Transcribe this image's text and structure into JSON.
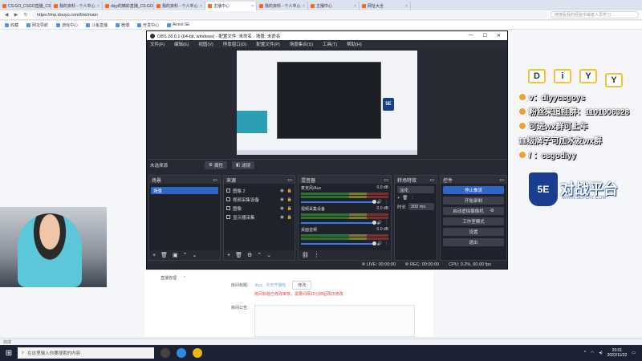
{
  "browser": {
    "tabs": [
      {
        "label": "CS:GO_CSGO直播_CS..",
        "active": false
      },
      {
        "label": "我的资料 - 个人中心",
        "active": false
      },
      {
        "label": "diyy的精彩直播_CS:GO直播",
        "active": false
      },
      {
        "label": "我的资料 - 个人中心",
        "active": false
      },
      {
        "label": "主播中心",
        "active": true
      },
      {
        "label": "我的资料 - 个人中心",
        "active": false
      },
      {
        "label": "主播中心",
        "active": false
      },
      {
        "label": "网址大全",
        "active": false
      }
    ],
    "url": "https://mp.douyu.com/live/main",
    "search_placeholder": "搜搜看我的经验中或者人员学习",
    "bookmarks": [
      "收藏",
      "网址导航",
      "游戏中心",
      "斗鱼直播",
      "微博",
      "开发中心",
      "Arrest SE"
    ]
  },
  "page": {
    "form": {
      "title_label": "房间标题:",
      "title_value": "diyy，今天开播啦",
      "edit_button": "修改",
      "warning": "房间标题已修改审核，需要间隔10分钟后再次修改",
      "notice_label": "房间公告:",
      "live_manage": "直播管理"
    },
    "statusbar": "完成"
  },
  "overlay": {
    "letters": [
      "D",
      "i",
      "Y",
      "Y"
    ],
    "lines": [
      "v：diyycsgoys",
      "粉丝来追挂群：1101906328",
      "可进wx群可上车",
      "11级牌子可加水友wx群",
      "/ ：csgodiyy"
    ],
    "se_logo": "5E",
    "se_text": "对战平台",
    "se_url": "WWW.5EPLAY.COM"
  },
  "obs": {
    "title": "OBS 28.0.1 (64-bit, windows) - 配置文件: 未命名 - 场景: 未命名",
    "window_controls": [
      "—",
      "☐",
      "✕"
    ],
    "menu": [
      "文件(F)",
      "编辑(E)",
      "视图(V)",
      "停靠窗口(D)",
      "配置文件(P)",
      "场景集合(S)",
      "工具(T)",
      "帮助(H)"
    ],
    "source_bar": {
      "label": "未选择源",
      "props": "属性",
      "filters": "滤镜"
    },
    "scenes": {
      "title": "场景",
      "items": [
        "场景"
      ]
    },
    "sources": {
      "title": "来源",
      "items": [
        "图像 2",
        "视频采集设备",
        "图像",
        "显示器采集"
      ]
    },
    "mixer": {
      "title": "混音器",
      "channels": [
        {
          "name": "麦克风/Aux",
          "db": "0.0 dB"
        },
        {
          "name": "视频采集设备",
          "db": "0.0 dB"
        },
        {
          "name": "桌面音频",
          "db": "0.0 dB"
        }
      ]
    },
    "transitions": {
      "title": "转场特效",
      "type": "淡化",
      "duration_label": "时长",
      "duration": "300 ms"
    },
    "controls": {
      "title": "控件",
      "buttons": [
        "停止推流",
        "开始录制",
        "启动虚拟摄像机",
        "工作室模式",
        "设置",
        "退出"
      ]
    },
    "status": {
      "live": "LIVE: 00:00:00",
      "rec": "REC: 00:00:00",
      "cpu": "CPU: 0.2%, 60.00 fps"
    }
  },
  "taskbar": {
    "search_placeholder": "在这里输入你要搜索的内容",
    "time": "20:01",
    "date": "2022/11/22"
  }
}
